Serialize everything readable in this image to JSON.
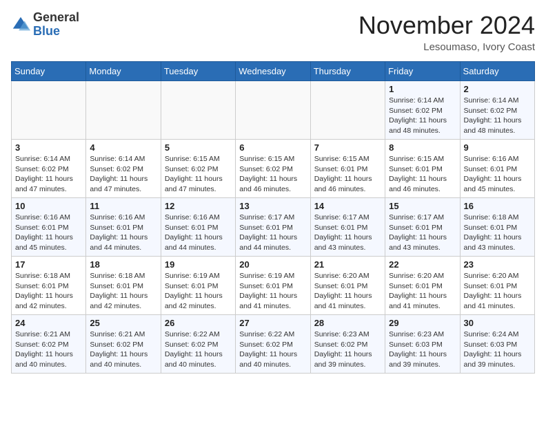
{
  "header": {
    "logo_general": "General",
    "logo_blue": "Blue",
    "month_year": "November 2024",
    "location": "Lesoumaso, Ivory Coast"
  },
  "weekdays": [
    "Sunday",
    "Monday",
    "Tuesday",
    "Wednesday",
    "Thursday",
    "Friday",
    "Saturday"
  ],
  "weeks": [
    [
      {
        "day": "",
        "info": ""
      },
      {
        "day": "",
        "info": ""
      },
      {
        "day": "",
        "info": ""
      },
      {
        "day": "",
        "info": ""
      },
      {
        "day": "",
        "info": ""
      },
      {
        "day": "1",
        "info": "Sunrise: 6:14 AM\nSunset: 6:02 PM\nDaylight: 11 hours and 48 minutes."
      },
      {
        "day": "2",
        "info": "Sunrise: 6:14 AM\nSunset: 6:02 PM\nDaylight: 11 hours and 48 minutes."
      }
    ],
    [
      {
        "day": "3",
        "info": "Sunrise: 6:14 AM\nSunset: 6:02 PM\nDaylight: 11 hours and 47 minutes."
      },
      {
        "day": "4",
        "info": "Sunrise: 6:14 AM\nSunset: 6:02 PM\nDaylight: 11 hours and 47 minutes."
      },
      {
        "day": "5",
        "info": "Sunrise: 6:15 AM\nSunset: 6:02 PM\nDaylight: 11 hours and 47 minutes."
      },
      {
        "day": "6",
        "info": "Sunrise: 6:15 AM\nSunset: 6:02 PM\nDaylight: 11 hours and 46 minutes."
      },
      {
        "day": "7",
        "info": "Sunrise: 6:15 AM\nSunset: 6:01 PM\nDaylight: 11 hours and 46 minutes."
      },
      {
        "day": "8",
        "info": "Sunrise: 6:15 AM\nSunset: 6:01 PM\nDaylight: 11 hours and 46 minutes."
      },
      {
        "day": "9",
        "info": "Sunrise: 6:16 AM\nSunset: 6:01 PM\nDaylight: 11 hours and 45 minutes."
      }
    ],
    [
      {
        "day": "10",
        "info": "Sunrise: 6:16 AM\nSunset: 6:01 PM\nDaylight: 11 hours and 45 minutes."
      },
      {
        "day": "11",
        "info": "Sunrise: 6:16 AM\nSunset: 6:01 PM\nDaylight: 11 hours and 44 minutes."
      },
      {
        "day": "12",
        "info": "Sunrise: 6:16 AM\nSunset: 6:01 PM\nDaylight: 11 hours and 44 minutes."
      },
      {
        "day": "13",
        "info": "Sunrise: 6:17 AM\nSunset: 6:01 PM\nDaylight: 11 hours and 44 minutes."
      },
      {
        "day": "14",
        "info": "Sunrise: 6:17 AM\nSunset: 6:01 PM\nDaylight: 11 hours and 43 minutes."
      },
      {
        "day": "15",
        "info": "Sunrise: 6:17 AM\nSunset: 6:01 PM\nDaylight: 11 hours and 43 minutes."
      },
      {
        "day": "16",
        "info": "Sunrise: 6:18 AM\nSunset: 6:01 PM\nDaylight: 11 hours and 43 minutes."
      }
    ],
    [
      {
        "day": "17",
        "info": "Sunrise: 6:18 AM\nSunset: 6:01 PM\nDaylight: 11 hours and 42 minutes."
      },
      {
        "day": "18",
        "info": "Sunrise: 6:18 AM\nSunset: 6:01 PM\nDaylight: 11 hours and 42 minutes."
      },
      {
        "day": "19",
        "info": "Sunrise: 6:19 AM\nSunset: 6:01 PM\nDaylight: 11 hours and 42 minutes."
      },
      {
        "day": "20",
        "info": "Sunrise: 6:19 AM\nSunset: 6:01 PM\nDaylight: 11 hours and 41 minutes."
      },
      {
        "day": "21",
        "info": "Sunrise: 6:20 AM\nSunset: 6:01 PM\nDaylight: 11 hours and 41 minutes."
      },
      {
        "day": "22",
        "info": "Sunrise: 6:20 AM\nSunset: 6:01 PM\nDaylight: 11 hours and 41 minutes."
      },
      {
        "day": "23",
        "info": "Sunrise: 6:20 AM\nSunset: 6:01 PM\nDaylight: 11 hours and 41 minutes."
      }
    ],
    [
      {
        "day": "24",
        "info": "Sunrise: 6:21 AM\nSunset: 6:02 PM\nDaylight: 11 hours and 40 minutes."
      },
      {
        "day": "25",
        "info": "Sunrise: 6:21 AM\nSunset: 6:02 PM\nDaylight: 11 hours and 40 minutes."
      },
      {
        "day": "26",
        "info": "Sunrise: 6:22 AM\nSunset: 6:02 PM\nDaylight: 11 hours and 40 minutes."
      },
      {
        "day": "27",
        "info": "Sunrise: 6:22 AM\nSunset: 6:02 PM\nDaylight: 11 hours and 40 minutes."
      },
      {
        "day": "28",
        "info": "Sunrise: 6:23 AM\nSunset: 6:02 PM\nDaylight: 11 hours and 39 minutes."
      },
      {
        "day": "29",
        "info": "Sunrise: 6:23 AM\nSunset: 6:03 PM\nDaylight: 11 hours and 39 minutes."
      },
      {
        "day": "30",
        "info": "Sunrise: 6:24 AM\nSunset: 6:03 PM\nDaylight: 11 hours and 39 minutes."
      }
    ]
  ]
}
